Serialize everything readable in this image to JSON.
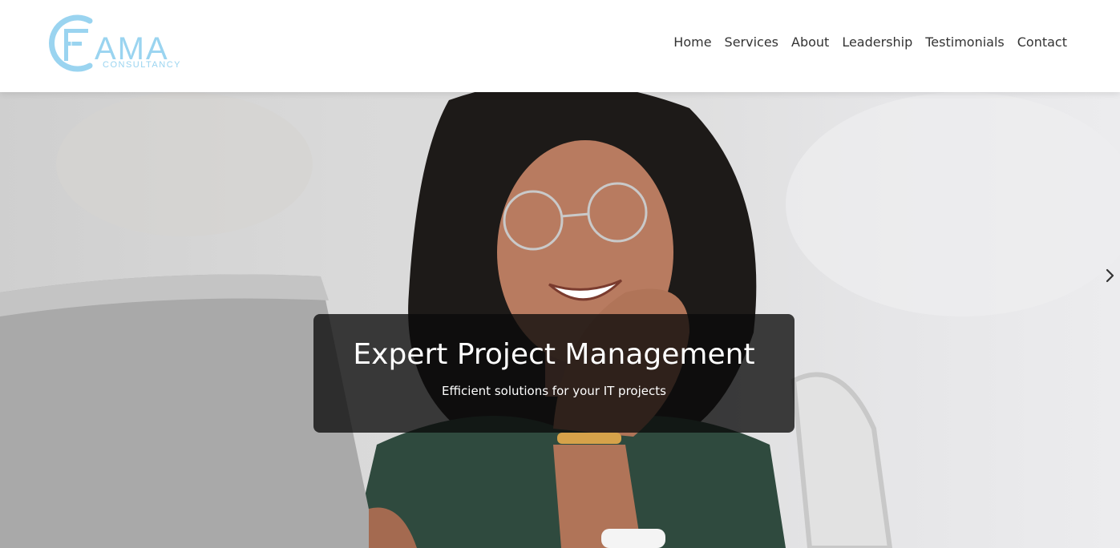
{
  "brand": {
    "logo_text": "FAMA",
    "logo_subtext": "CONSULTANCY",
    "logo_color": "#9ad4f0"
  },
  "nav": {
    "items": [
      {
        "label": "Home"
      },
      {
        "label": "Services"
      },
      {
        "label": "About"
      },
      {
        "label": "Leadership"
      },
      {
        "label": "Testimonials"
      },
      {
        "label": "Contact"
      }
    ]
  },
  "hero": {
    "title": "Expert Project Management",
    "subtitle": "Efficient solutions for your IT projects",
    "next_icon": "chevron-right-icon"
  }
}
